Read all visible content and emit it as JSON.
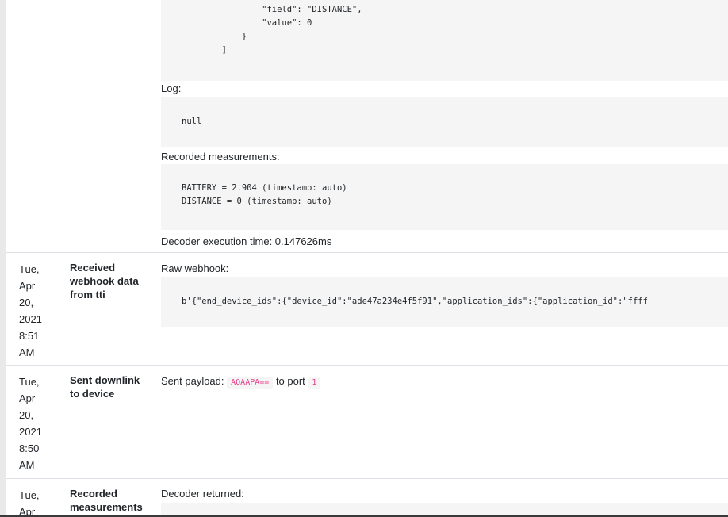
{
  "entries": [
    {
      "date": [],
      "event": "",
      "decoder_code": "                \"field\": \"DISTANCE\",\n                \"value\": 0\n            }\n        ]",
      "log_label": "Log:",
      "log_value": "null",
      "recorded_label": "Recorded measurements:",
      "recorded_value": "BATTERY = 2.904 (timestamp: auto)\nDISTANCE = 0 (timestamp: auto)",
      "exec_time": "Decoder execution time: 0.147626ms"
    },
    {
      "date": [
        "Tue,",
        "Apr",
        "20,",
        "2021",
        "8:51",
        "AM"
      ],
      "event": "Received webhook data from tti",
      "raw_label": "Raw webhook:",
      "raw_value": "b'{\"end_device_ids\":{\"device_id\":\"ade47a234e4f5f91\",\"application_ids\":{\"application_id\":\"ffff"
    },
    {
      "date": [
        "Tue,",
        "Apr",
        "20,",
        "2021",
        "8:50",
        "AM"
      ],
      "event": "Sent downlink to device",
      "payload_prefix": "Sent payload:",
      "payload_value": "AQAAPA==",
      "port_prefix": "to port",
      "port_value": "1"
    },
    {
      "date": [
        "Tue,",
        "Apr"
      ],
      "event": "Recorded measurements",
      "decoder_label": "Decoder returned:"
    }
  ],
  "colors": {
    "code_bg": "#f5f5f5",
    "inline_code": "#e83e8c",
    "divider": "#dee2e6"
  }
}
